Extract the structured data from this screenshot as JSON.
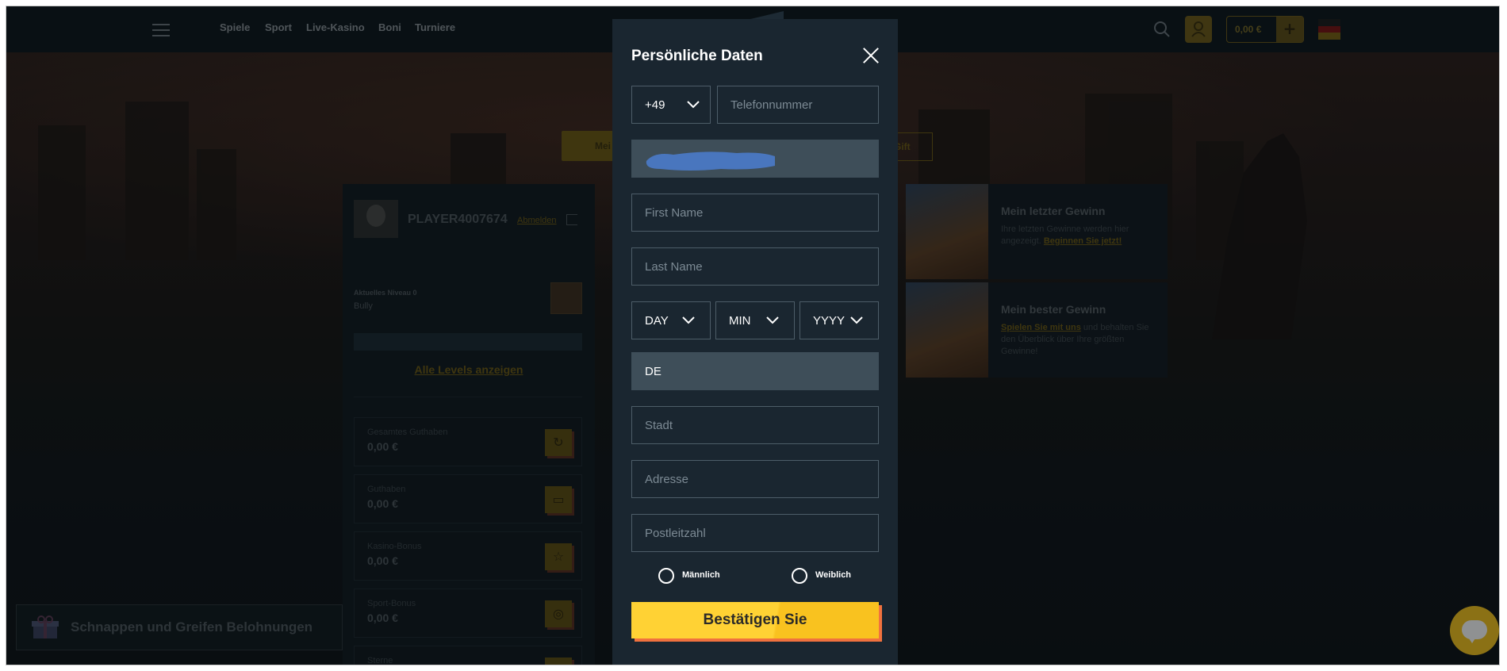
{
  "nav": {
    "links": [
      "Spiele",
      "Sport",
      "Live-Kasino",
      "Boni",
      "Turniere"
    ],
    "balance": "0,00 €",
    "add_label": "+"
  },
  "hero": {
    "left_button_label": "Mei",
    "right_button_label": "Gift"
  },
  "profile": {
    "username": "PLAYER4007674",
    "logout_label": "Abmelden",
    "level_label": "Aktuelles Niveau 0",
    "level_name": "Bully",
    "all_levels_link": "Alle Levels anzeigen",
    "balances": [
      {
        "label": "Gesamtes Guthaben",
        "value": "0,00 €",
        "icon": "refresh-icon"
      },
      {
        "label": "Guthaben",
        "value": "0,00 €",
        "icon": "wallet-icon"
      },
      {
        "label": "Kasino-Bonus",
        "value": "0,00 €",
        "icon": "star-icon"
      },
      {
        "label": "Sport-Bonus",
        "value": "0,00 €",
        "icon": "ball-icon"
      },
      {
        "label": "Sterne",
        "value": "",
        "icon": "cart-icon"
      }
    ]
  },
  "tiles": [
    {
      "title": "Mein letzter Gewinn",
      "text": "Ihre letzten Gewinne werden hier angezeigt.",
      "link": "Beginnen Sie jetzt!",
      "text_after": ""
    },
    {
      "title": "Mein bester Gewinn",
      "text": "",
      "link": "Spielen Sie mit uns",
      "text_after": " und behalten Sie den Überblick über Ihre größten Gewinne!"
    }
  ],
  "reward": {
    "label": "Schnappen und Greifen Belohnungen"
  },
  "modal": {
    "title": "Persönliche Daten",
    "phone_code": "+49",
    "phone_placeholder": "Telefonnummer",
    "first_name_placeholder": "First Name",
    "last_name_placeholder": "Last Name",
    "day_label": "DAY",
    "month_label": "MIN",
    "year_label": "YYYY",
    "country_value": "DE",
    "city_placeholder": "Stadt",
    "address_placeholder": "Adresse",
    "zip_placeholder": "Postleitzahl",
    "gender_male": "Männlich",
    "gender_female": "Weiblich",
    "submit_label": "Bestätigen Sie"
  },
  "colors": {
    "accent": "#ffd234",
    "modal_bg": "#1a2630",
    "field_border": "#4d5d68",
    "filled_field": "#3e4e59",
    "submit_shadow": "#f0713e",
    "redacted": "#4a78c4"
  }
}
